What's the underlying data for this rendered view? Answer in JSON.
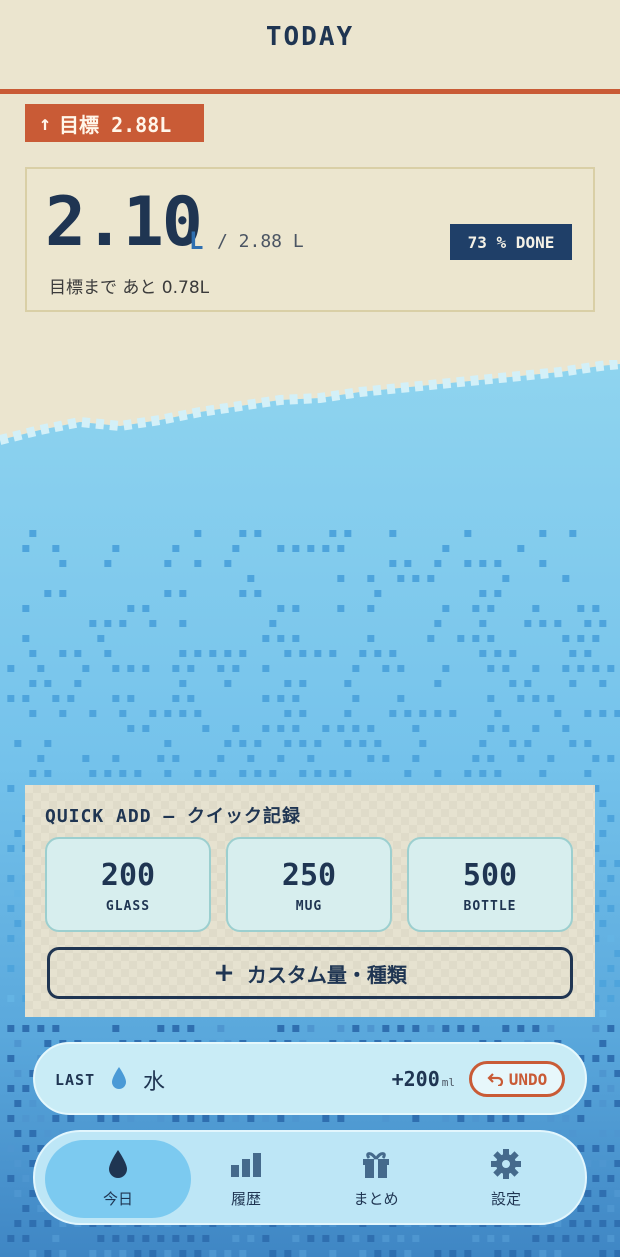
{
  "header": {
    "title": "TODAY"
  },
  "goal_badge": {
    "arrow": "↑",
    "label": "目標 2.88L"
  },
  "progress": {
    "current": "2.10",
    "unit": "L",
    "total": "/ 2.88 L",
    "percent_label": "73 % DONE",
    "percent_value": 0.73,
    "remaining": "目標まで あと 0.78L"
  },
  "quick_add": {
    "title": "QUICK ADD — クイック記録",
    "buttons": [
      {
        "amount": "200",
        "label": "GLASS"
      },
      {
        "amount": "250",
        "label": "MUG"
      },
      {
        "amount": "500",
        "label": "BOTTLE"
      }
    ],
    "custom": {
      "plus": "+",
      "label": "カスタム量・種類"
    }
  },
  "last_entry": {
    "label": "LAST",
    "icon": "water-drop-icon",
    "beverage": "水",
    "amount": "+200",
    "unit": "ml",
    "undo_label": "UNDO"
  },
  "nav": {
    "items": [
      {
        "label": "今日",
        "icon": "drop-icon",
        "active": true
      },
      {
        "label": "履歴",
        "icon": "bar-chart-icon",
        "active": false
      },
      {
        "label": "まとめ",
        "icon": "gift-icon",
        "active": false
      },
      {
        "label": "設定",
        "icon": "gear-icon",
        "active": false
      }
    ]
  },
  "colors": {
    "accent": "#c95b36",
    "ink": "#1f3552",
    "paper": "#ebe5cf",
    "water_light": "#8dd3ef",
    "water_deep": "#3f86c4"
  }
}
